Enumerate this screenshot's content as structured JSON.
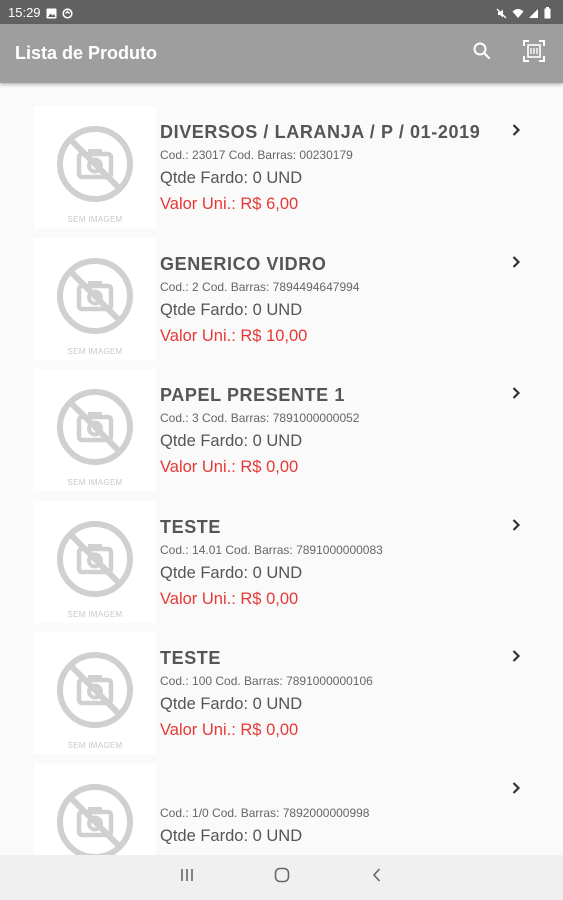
{
  "status_bar": {
    "time": "15:29"
  },
  "app_bar": {
    "title": "Lista de Produto",
    "search_icon": "search-icon",
    "scan_icon": "barcode-scan-icon"
  },
  "colors": {
    "app_bar": "#9e9e9e",
    "status_bar": "#616161",
    "price": "#e53935"
  },
  "products": [
    {
      "name": "DIVERSOS / LARANJA / P / 01-2019",
      "codes": "Cod.: 23017 Cod. Barras: 00230179",
      "qtde": "Qtde Fardo: 0 UND",
      "valor": "Valor Uni.: R$ 6,00",
      "image_caption": "SEM IMAGEM"
    },
    {
      "name": "GENERICO VIDRO",
      "codes": "Cod.: 2 Cod. Barras: 7894494647994",
      "qtde": "Qtde Fardo: 0 UND",
      "valor": "Valor Uni.: R$ 10,00",
      "image_caption": "SEM IMAGEM"
    },
    {
      "name": "PAPEL PRESENTE 1",
      "codes": "Cod.: 3 Cod. Barras: 7891000000052",
      "qtde": "Qtde Fardo: 0 UND",
      "valor": "Valor Uni.: R$ 0,00",
      "image_caption": "SEM IMAGEM"
    },
    {
      "name": "TESTE",
      "codes": "Cod.: 14.01 Cod. Barras: 7891000000083",
      "qtde": "Qtde Fardo: 0 UND",
      "valor": "Valor Uni.: R$ 0,00",
      "image_caption": "SEM IMAGEM"
    },
    {
      "name": "TESTE",
      "codes": "Cod.: 100 Cod. Barras: 7891000000106",
      "qtde": "Qtde Fardo: 0 UND",
      "valor": "Valor Uni.: R$ 0,00",
      "image_caption": "SEM IMAGEM"
    },
    {
      "name": "",
      "codes": "Cod.: 1/0 Cod. Barras: 7892000000998",
      "qtde": "Qtde Fardo: 0 UND",
      "valor": "",
      "image_caption": ""
    }
  ]
}
